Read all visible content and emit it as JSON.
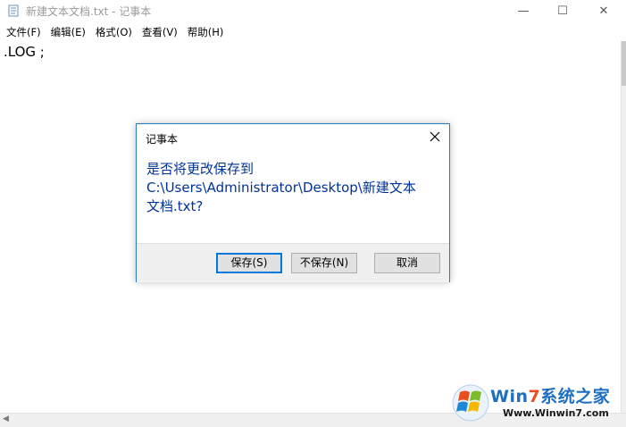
{
  "window": {
    "title": "新建文本文档.txt - 记事本",
    "minimize_glyph": "—",
    "maximize_glyph": "☐",
    "close_glyph": "✕"
  },
  "menu": {
    "items": [
      "文件(F)",
      "编辑(E)",
      "格式(O)",
      "查看(V)",
      "帮助(H)"
    ]
  },
  "editor": {
    "content": ".LOG ;"
  },
  "dialog": {
    "title": "记事本",
    "message_lines": [
      "是否将更改保存到",
      "C:\\Users\\Administrator\\Desktop\\新建文本",
      "文档.txt?"
    ],
    "buttons": {
      "save": "保存(S)",
      "dont_save": "不保存(N)",
      "cancel": "取消"
    }
  },
  "watermark": {
    "brand_prefix": "Win",
    "brand_seven": "7",
    "brand_suffix": "系统之家",
    "url": "Www.Winwin7.com"
  },
  "colors": {
    "dialog_text": "#003399",
    "dialog_border": "#2b79c4",
    "default_button_border": "#0078d7"
  },
  "icons": {
    "app": "notepad-icon",
    "dialog_close": "close-icon",
    "watermark_logo": "windows-logo-icon"
  }
}
